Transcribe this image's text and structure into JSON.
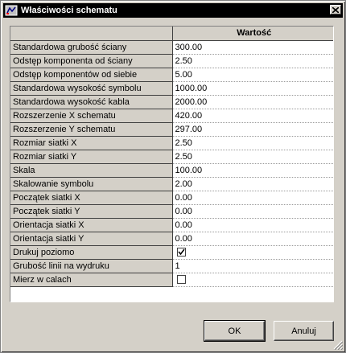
{
  "window": {
    "title": "Właściwości schematu"
  },
  "grid": {
    "header_value": "Wartość",
    "rows": [
      {
        "name": "Standardowa grubość ściany",
        "value": "300.00"
      },
      {
        "name": "Odstęp komponenta od ściany",
        "value": "2.50"
      },
      {
        "name": "Odstęp komponentów od siebie",
        "value": "5.00"
      },
      {
        "name": "Standardowa wysokość symbolu",
        "value": "1000.00"
      },
      {
        "name": "Standardowa wysokość kabla",
        "value": "2000.00"
      },
      {
        "name": "Rozszerzenie X schematu",
        "value": "420.00"
      },
      {
        "name": "Rozszerzenie Y schematu",
        "value": "297.00"
      },
      {
        "name": "Rozmiar siatki X",
        "value": "2.50"
      },
      {
        "name": "Rozmiar siatki Y",
        "value": "2.50"
      },
      {
        "name": "Skala",
        "value": "100.00"
      },
      {
        "name": "Skalowanie symbolu",
        "value": "2.00"
      },
      {
        "name": "Początek siatki X",
        "value": "0.00"
      },
      {
        "name": "Początek siatki Y",
        "value": "0.00"
      },
      {
        "name": "Orientacja siatki X",
        "value": "0.00"
      },
      {
        "name": "Orientacja siatki Y",
        "value": "0.00"
      },
      {
        "name": "Drukuj poziomo",
        "checkbox": true,
        "checked": true
      },
      {
        "name": "Grubość linii na wydruku",
        "value": "1"
      },
      {
        "name": "Mierz w calach",
        "checkbox": true,
        "checked": false
      }
    ]
  },
  "buttons": {
    "ok": "OK",
    "cancel": "Anuluj"
  },
  "icons": {
    "app": "schematic-app-icon",
    "close": "close-icon",
    "check": "check-icon",
    "grip": "resize-grip-icon"
  }
}
